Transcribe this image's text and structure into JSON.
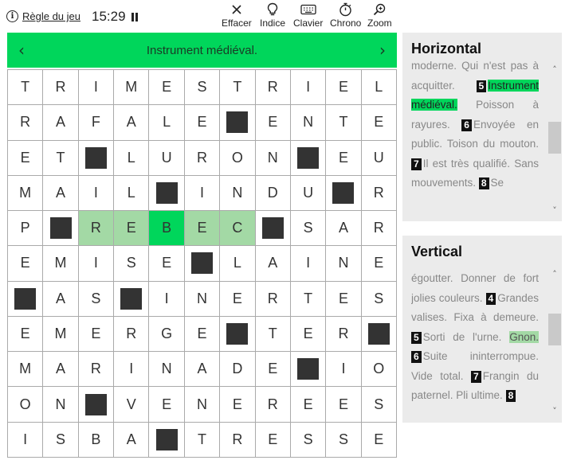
{
  "header": {
    "rules_label": "Règle du jeu",
    "timer": "15:29",
    "tools": [
      {
        "label": "Effacer",
        "icon": "x-icon"
      },
      {
        "label": "Indice",
        "icon": "lightbulb-icon"
      },
      {
        "label": "Clavier",
        "icon": "keyboard-icon"
      },
      {
        "label": "Chrono",
        "icon": "stopwatch-icon"
      },
      {
        "label": "Zoom",
        "icon": "magnifier-icon"
      }
    ]
  },
  "clue_bar": {
    "text": "Instrument médiéval.",
    "prev_icon": "‹",
    "next_icon": "›"
  },
  "grid": {
    "rows": [
      [
        "T",
        "R",
        "I",
        "M",
        "E",
        "S",
        "T",
        "R",
        "I",
        "E",
        "L"
      ],
      [
        "R",
        "A",
        "F",
        "A",
        "L",
        "E",
        "#",
        "E",
        "N",
        "T",
        "E"
      ],
      [
        "E",
        "T",
        "#",
        "L",
        "U",
        "R",
        "O",
        "N",
        "#",
        "E",
        "U"
      ],
      [
        "M",
        "A",
        "I",
        "L",
        "#",
        "I",
        "N",
        "D",
        "U",
        "#",
        "R"
      ],
      [
        "P",
        "#",
        "R",
        "E",
        "B",
        "E",
        "C",
        "#",
        "S",
        "A",
        "R"
      ],
      [
        "E",
        "M",
        "I",
        "S",
        "E",
        "#",
        "L",
        "A",
        "I",
        "N",
        "E"
      ],
      [
        "#",
        "A",
        "S",
        "#",
        "I",
        "N",
        "E",
        "R",
        "T",
        "E",
        "S"
      ],
      [
        "E",
        "M",
        "E",
        "R",
        "G",
        "E",
        "#",
        "T",
        "E",
        "R",
        "#"
      ],
      [
        "M",
        "A",
        "R",
        "I",
        "N",
        "A",
        "D",
        "E",
        "#",
        "I",
        "O"
      ],
      [
        "O",
        "N",
        "#",
        "V",
        "E",
        "N",
        "E",
        "R",
        "E",
        "E",
        "S"
      ],
      [
        "I",
        "S",
        "B",
        "A",
        "#",
        "T",
        "R",
        "E",
        "S",
        "S",
        "E"
      ]
    ],
    "highlight_row": 4,
    "highlight_cols": [
      2,
      3,
      4,
      5,
      6
    ],
    "cursor": {
      "row": 4,
      "col": 4
    }
  },
  "horizontal": {
    "title": "Horizontal",
    "top_fragment": "moderne. Qui n'est pas à",
    "line_pre": "acquitter.",
    "num5": "5",
    "active_clue": "Instrument médiéval.",
    "after5": "Poisson à rayures.",
    "num6": "6",
    "clue6": "Envoyée en public. Toison du mouton.",
    "num7": "7",
    "clue7": "Il est très qualifié. Sans mouvements.",
    "num8": "8",
    "clue8": "Se"
  },
  "vertical": {
    "title": "Vertical",
    "line_pre": "égoutter. Donner de fort jolies couleurs.",
    "num4": "4",
    "clue4": "Grandes valises. Fixa à demeure.",
    "num5": "5",
    "clue5_a": "Sorti de l'urne.",
    "cross_clue": "Gnon.",
    "num6": "6",
    "clue6": "Suite ininterrompue. Vide total.",
    "num7": "7",
    "clue7": "Frangin du paternel. Pli ultime.",
    "num8": "8"
  },
  "colors": {
    "accent": "#00d65b",
    "cross": "#a3d9a5",
    "block": "#333333",
    "panel": "#ebebeb"
  }
}
